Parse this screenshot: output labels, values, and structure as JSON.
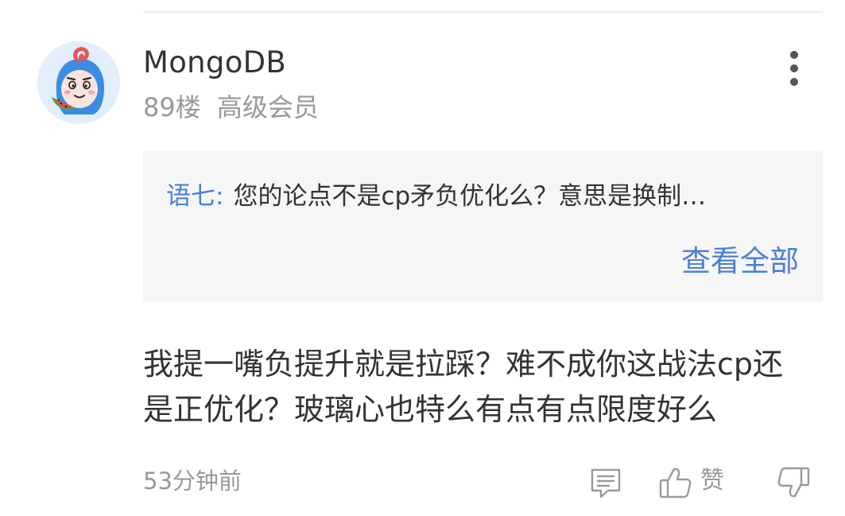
{
  "comment": {
    "username": "MongoDB",
    "floor": "89楼",
    "member_level": "高级会员",
    "quote": {
      "author": "语七:",
      "text": "您的论点不是cp矛负优化么？意思是换制…",
      "view_all_label": "查看全部"
    },
    "body_lines": [
      "我提一嘴负提升就是拉踩？难不成你这战法cp还",
      "是正优化？玻璃心也特么有点有点限度好么"
    ],
    "timestamp": "53分钟前",
    "like_label": "赞"
  },
  "icons": {
    "more": "more-vertical-icon",
    "reply": "reply-icon",
    "like": "thumbs-up-icon",
    "dislike": "thumbs-down-icon"
  },
  "colors": {
    "accent": "#4a7fd4",
    "text": "#333333",
    "muted": "#999999",
    "quote_background": "#f6f6f6",
    "avatar_background": "#e2eefb",
    "avatar_hood": "#3a8de0"
  }
}
